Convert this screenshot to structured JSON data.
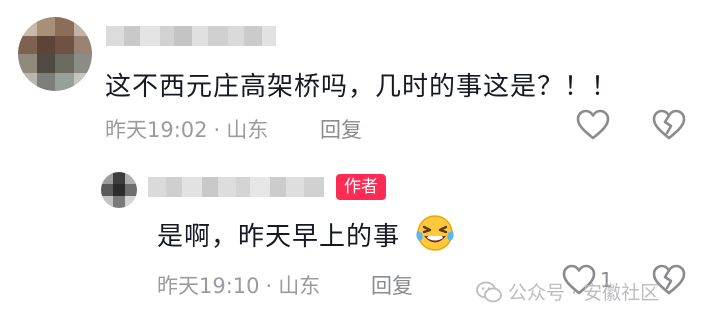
{
  "comment": {
    "text": "这不西元庄高架桥吗，几时的事这是？！！",
    "time": "昨天19:02",
    "location": "山东",
    "separator": "·",
    "reply_label": "回复"
  },
  "reply": {
    "author_badge": "作者",
    "text": "是啊，昨天早上的事",
    "emoji": "laughing-tears-emoji",
    "time": "昨天19:10",
    "location": "山东",
    "separator": "·",
    "reply_label": "回复",
    "like_count": "1"
  },
  "watermark": {
    "text": "公众号 · 安徽社区"
  },
  "colors": {
    "author_badge_bg": "#fe2c55",
    "meta_text": "#9a9ba1",
    "icon_stroke": "#8a8b91"
  },
  "icons": [
    "heart-outline-icon",
    "broken-heart-icon",
    "wechat-watermark-icon",
    "laughing-tears-emoji"
  ]
}
